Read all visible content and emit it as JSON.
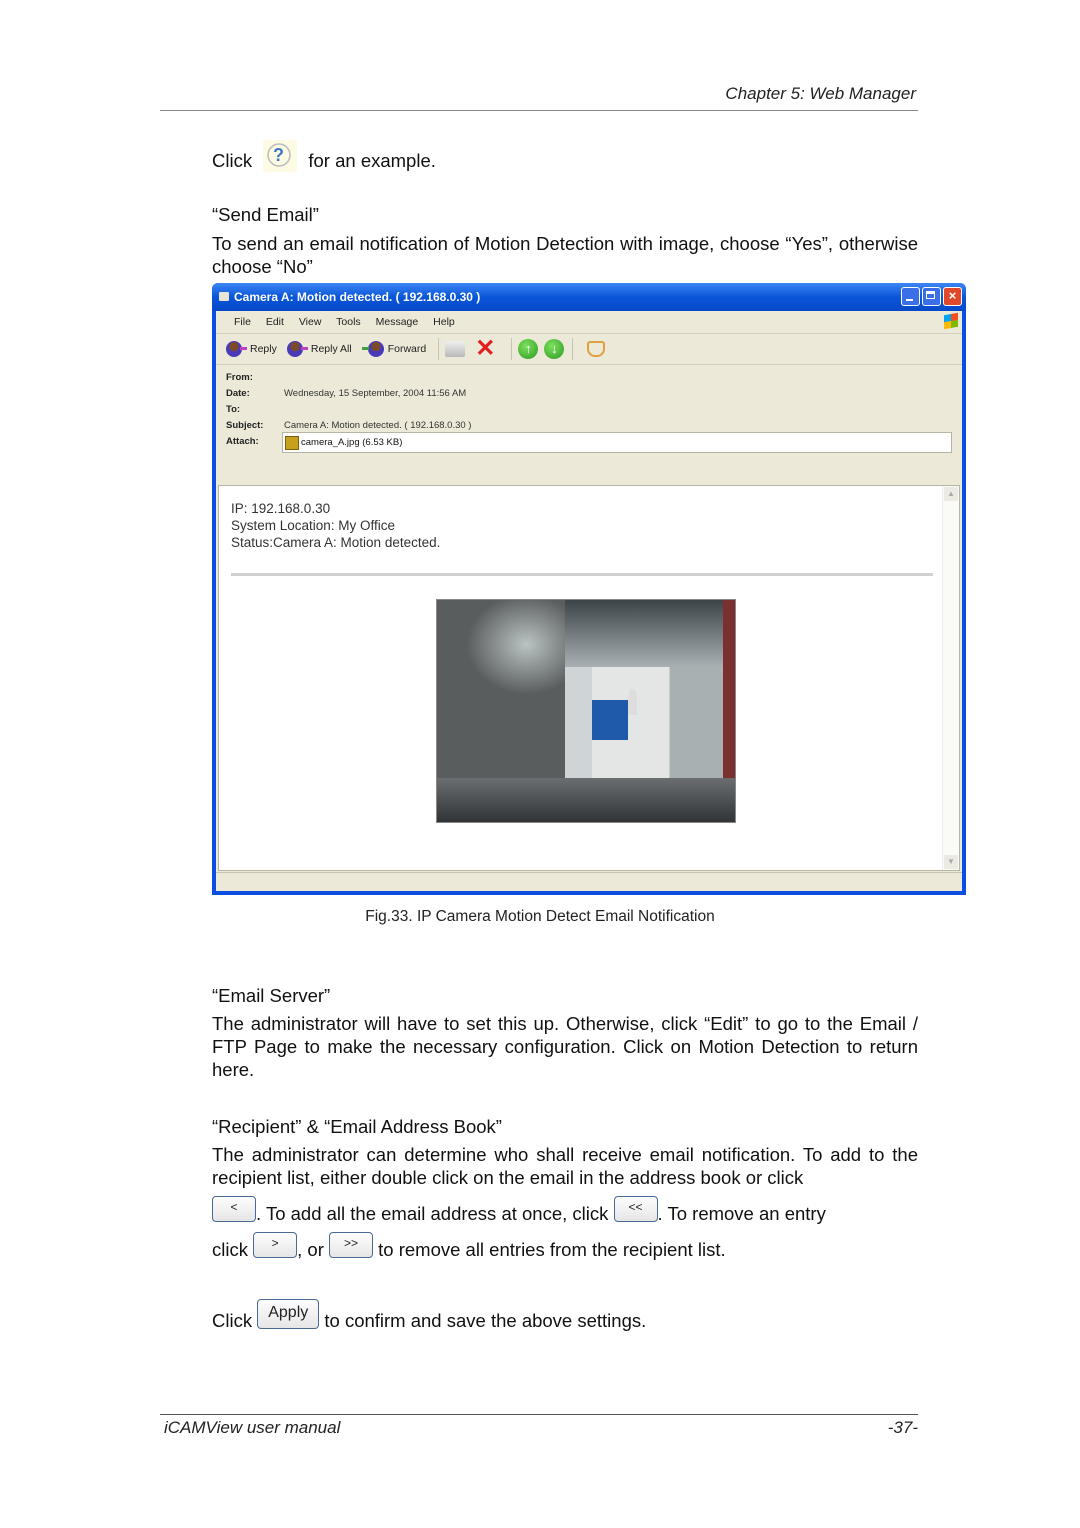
{
  "page_header": {
    "chapter": "Chapter 5: Web Manager"
  },
  "intro": {
    "click": "Click",
    "after_icon": "for an example.",
    "icon": "help-question-icon"
  },
  "send_email": {
    "heading": "“Send Email”",
    "text": "To send an email notification of Motion Detection with image, choose “Yes”, otherwise choose “No”"
  },
  "email_window": {
    "title": "Camera A: Motion detected. ( 192.168.0.30 )",
    "menu": [
      "File",
      "Edit",
      "View",
      "Tools",
      "Message",
      "Help"
    ],
    "toolbar": {
      "reply": "Reply",
      "reply_all": "Reply All",
      "forward": "Forward",
      "print": "print-icon",
      "delete": "delete-icon",
      "previous": "↑",
      "next": "↓",
      "addresses": "address-book-icon"
    },
    "headers": {
      "from_label": "From:",
      "from_value": "",
      "date_label": "Date:",
      "date_value": "Wednesday, 15 September, 2004 11:56 AM",
      "to_label": "To:",
      "to_value": "",
      "subject_label": "Subject:",
      "subject_value": "Camera A: Motion detected. ( 192.168.0.30 )",
      "attach_label": "Attach:",
      "attach_value": "camera_A.jpg (6.53 KB)"
    },
    "body": {
      "line1": "IP: 192.168.0.30",
      "line2": "System Location: My Office",
      "line3": "Status:Camera A: Motion detected."
    }
  },
  "caption": "Fig.33.  IP Camera Motion Detect Email Notification",
  "email_server": {
    "heading": "“Email Server”",
    "text": "The administrator will have to set this up.   Otherwise, click “Edit” to go to the Email / FTP Page to make the necessary configuration. Click on Motion Detection to return here."
  },
  "recipient": {
    "heading": "“Recipient” & “Email Address Book”",
    "text1": "The administrator can determine who shall receive email notification.   To add to the recipient list, either double click on the email in the address book or click",
    "btn_add": "<",
    "text2": ".   To add all the email address at once, click",
    "btn_add_all": "<<",
    "text3": ".   To remove an entry",
    "text4": "click",
    "btn_remove": ">",
    "text5": ", or",
    "btn_remove_all": ">>",
    "text6": "to remove all entries from the recipient list."
  },
  "apply": {
    "click": "Click",
    "btn": "Apply",
    "text": "to confirm and save the above settings."
  },
  "footer": {
    "title": "iCAMView  user  manual",
    "page": "-37-"
  }
}
